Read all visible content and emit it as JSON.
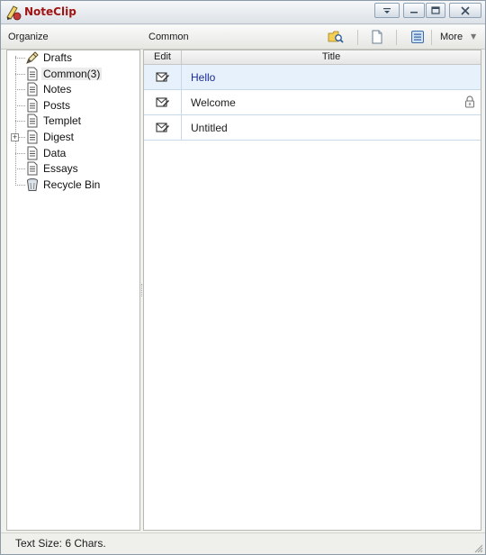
{
  "app": {
    "title": "NoteClip"
  },
  "header": {
    "left_label": "Organize",
    "right_label": "Common",
    "more_label": "More"
  },
  "tree": {
    "items": [
      {
        "label": "Drafts",
        "icon": "pencil-icon"
      },
      {
        "label": "Common(3)",
        "icon": "document-icon",
        "selected": true
      },
      {
        "label": "Notes",
        "icon": "document-icon"
      },
      {
        "label": "Posts",
        "icon": "document-icon"
      },
      {
        "label": "Templet",
        "icon": "document-icon"
      },
      {
        "label": "Digest",
        "icon": "document-icon",
        "expandable": true
      },
      {
        "label": "Data",
        "icon": "document-icon"
      },
      {
        "label": "Essays",
        "icon": "document-icon"
      },
      {
        "label": "Recycle Bin",
        "icon": "recycle-bin-icon"
      }
    ]
  },
  "grid": {
    "columns": {
      "edit": "Edit",
      "title": "Title"
    },
    "rows": [
      {
        "title": "Hello",
        "selected": true,
        "locked": false
      },
      {
        "title": "Welcome",
        "selected": false,
        "locked": true
      },
      {
        "title": "Untitled",
        "selected": false,
        "locked": false
      }
    ]
  },
  "status": {
    "text": "Text Size: 6 Chars."
  },
  "colors": {
    "accent_title": "#a11414",
    "selection": "#e6f1fb",
    "selected_text": "#1b2a9a"
  }
}
